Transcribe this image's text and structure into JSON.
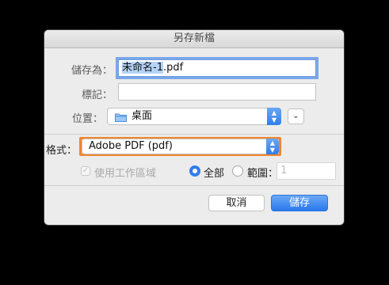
{
  "dialog": {
    "title": "另存新檔",
    "save_as_label": "儲存為：",
    "filename_selected": "未命名-1",
    "filename_ext": ".pdf",
    "tags_label": "標記：",
    "tags_value": "",
    "location_label": "位置：",
    "location_value": "桌面",
    "format_label": "格式：",
    "format_value": "Adobe PDF (pdf)",
    "use_workspace_label": "使用工作區域",
    "all_label": "全部",
    "range_label": "範圍：",
    "range_value": "1",
    "cancel_label": "取消",
    "save_label": "儲存"
  }
}
